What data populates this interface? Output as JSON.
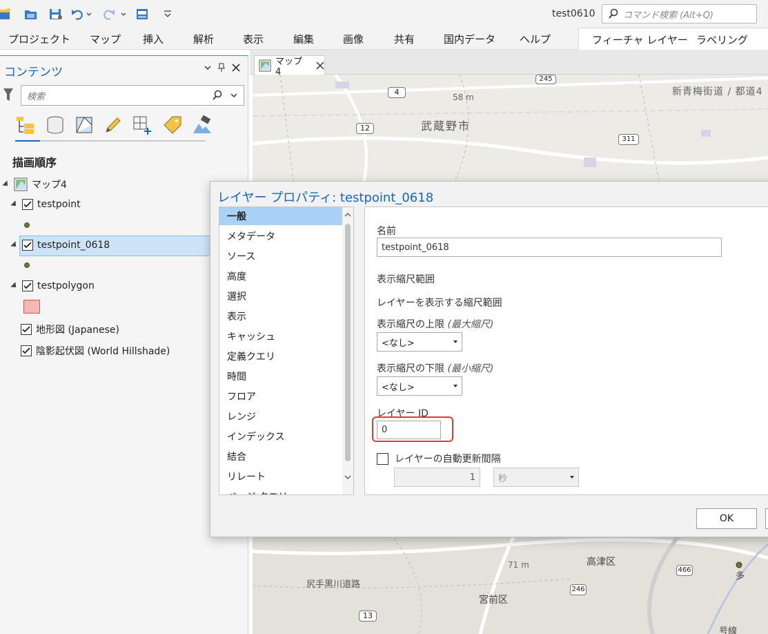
{
  "window": {
    "title": "test0610",
    "command_search_placeholder": "コマンド検索 (Alt+Q)"
  },
  "ribbon": {
    "tabs": [
      "プロジェクト",
      "マップ",
      "挿入",
      "解析",
      "表示",
      "編集",
      "画像",
      "共有",
      "国内データ",
      "ヘルプ"
    ],
    "context_tabs": [
      "フィーチャ レイヤー",
      "ラベリング"
    ]
  },
  "contents": {
    "title": "コンテンツ",
    "search_placeholder": "検索",
    "draw_order_label": "描画順序",
    "map_name": "マップ4",
    "layers": [
      {
        "name": "testpoint",
        "checked": true,
        "symbol": "point"
      },
      {
        "name": "testpoint_0618",
        "checked": true,
        "symbol": "point",
        "selected": true
      },
      {
        "name": "testpolygon",
        "checked": true,
        "symbol": "polygon"
      },
      {
        "name": "地形図 (Japanese)",
        "checked": true
      },
      {
        "name": "陰影起伏図 (World Hillshade)",
        "checked": true
      }
    ]
  },
  "map_view": {
    "tab_label": "マップ4",
    "labels": {
      "city_musashino": "武蔵野市",
      "road_shinome": "新青梅街道 / 都道4",
      "elev_58": "58 m",
      "elev_71": "71 m",
      "ward_takatsu": "高津区",
      "ward_miyamae": "宮前区",
      "road_shirite": "尻手黒川道路",
      "shield_4": "4",
      "shield_12": "12",
      "shield_245": "245",
      "shield_311": "311",
      "shield_246": "246",
      "shield_13": "13",
      "shield_466": "466",
      "edge_ta": "多",
      "edge_line": "号線"
    }
  },
  "dialog": {
    "title": "レイヤー プロパティ: testpoint_0618",
    "nav_items": [
      "一般",
      "メタデータ",
      "ソース",
      "高度",
      "選択",
      "表示",
      "キャッシュ",
      "定義クエリ",
      "時間",
      "フロア",
      "レンジ",
      "インデックス",
      "結合",
      "リレート",
      "ページ クエリ"
    ],
    "active_nav": "一般",
    "general": {
      "name_label": "名前",
      "name_value": "testpoint_0618",
      "scale_range_heading": "表示縮尺範囲",
      "scale_range_desc": "レイヤーを表示する縮尺範囲",
      "max_scale_label": "表示縮尺の上限",
      "max_scale_hint": "(最大縮尺)",
      "max_scale_value": "<なし>",
      "min_scale_label": "表示縮尺の下限",
      "min_scale_hint": "(最小縮尺)",
      "min_scale_value": "<なし>",
      "layer_id_label": "レイヤー ID",
      "layer_id_value": "0",
      "auto_refresh_label": "レイヤーの自動更新間隔",
      "auto_refresh_checked": false,
      "refresh_interval_value": "1",
      "refresh_unit_value": "秒"
    },
    "ok_label": "OK"
  },
  "colors": {
    "accent": "#1565c0",
    "selection": "#cfe3f7",
    "highlight_box": "#e53935",
    "polygon_fill": "#f4b8b4",
    "point_fill": "#6b7a2a"
  }
}
